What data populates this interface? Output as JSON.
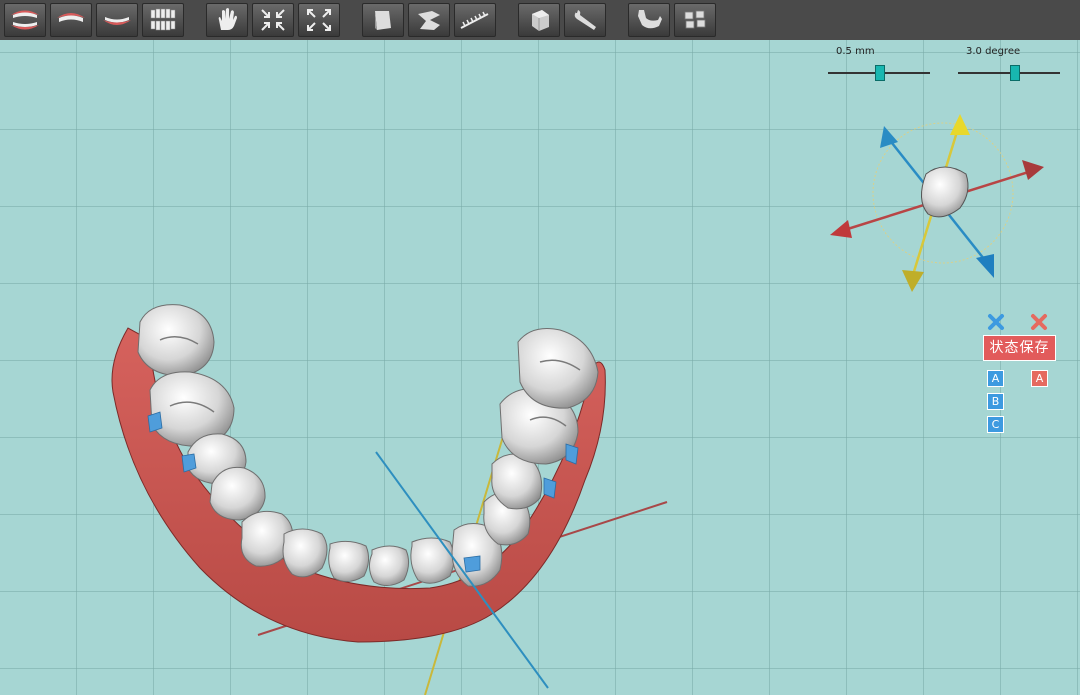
{
  "toolbar": {
    "buttons": [
      {
        "name": "view-both-arches-icon"
      },
      {
        "name": "view-upper-arch-icon"
      },
      {
        "name": "view-lower-arch-icon"
      },
      {
        "name": "view-teeth-only-icon"
      },
      {
        "name": "pan-hand-icon"
      },
      {
        "name": "zoom-in-icon"
      },
      {
        "name": "zoom-out-icon"
      },
      {
        "name": "attachment-icon"
      },
      {
        "name": "segment-icon"
      },
      {
        "name": "ruler-icon"
      },
      {
        "name": "cube-icon"
      },
      {
        "name": "wrench-icon"
      },
      {
        "name": "jaw-icon"
      },
      {
        "name": "brackets-icon"
      }
    ]
  },
  "controls": {
    "step_slider": {
      "label": "0.5 mm",
      "value_fraction": 0.5
    },
    "angle_slider": {
      "label": "3.0 degree",
      "value_fraction": 0.55
    }
  },
  "state_panel": {
    "save_label": "状态保存",
    "left_slots": [
      "A",
      "B",
      "C"
    ],
    "right_slots": [
      "A"
    ],
    "colors": {
      "blue": "#3d9ae0",
      "red": "#e56a5f"
    }
  },
  "gizmo": {
    "axis_colors": {
      "x": "#c0393b",
      "y": "#d9c92b",
      "z": "#1f8fc4"
    }
  }
}
